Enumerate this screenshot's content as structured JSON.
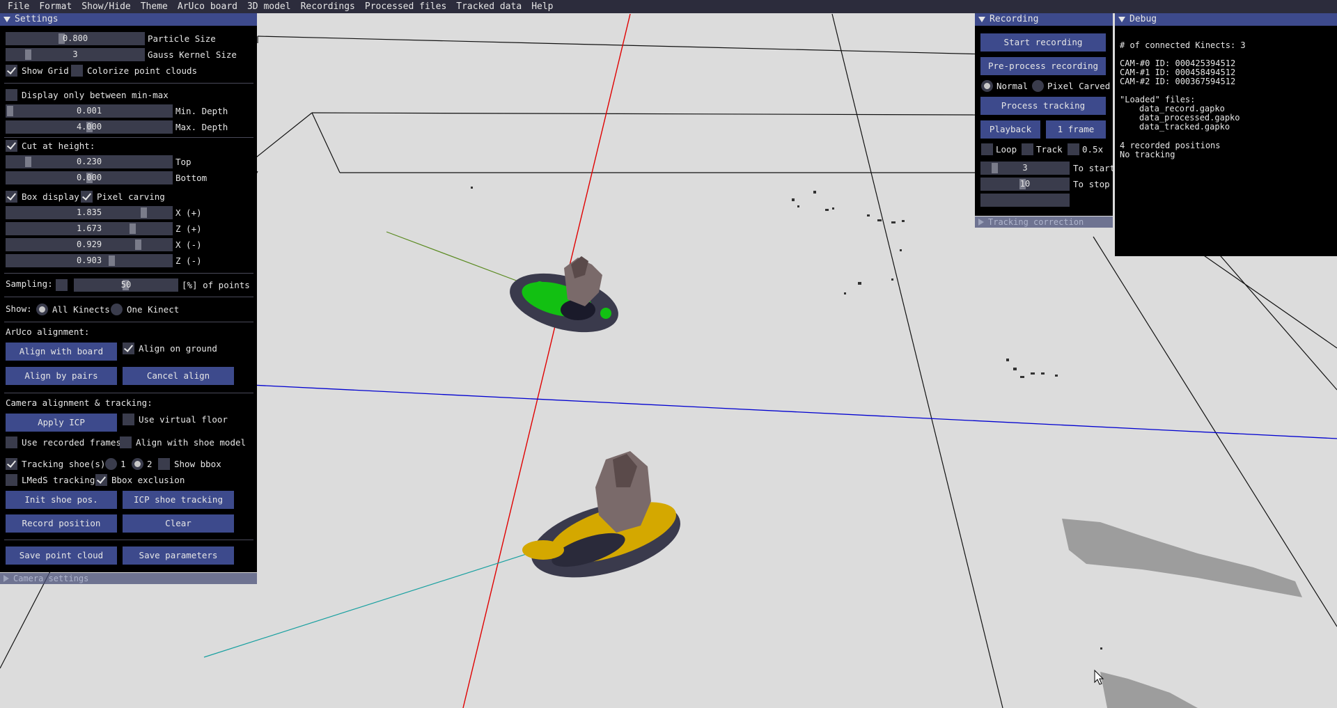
{
  "menubar": [
    "File",
    "Format",
    "Show/Hide",
    "Theme",
    "ArUco board",
    "3D model",
    "Recordings",
    "Processed files",
    "Tracked data",
    "Help"
  ],
  "settings": {
    "title": "Settings",
    "particle_size": {
      "value": "0.800",
      "label": "Particle Size"
    },
    "gauss_kernel": {
      "value": "3",
      "label": "Gauss Kernel Size"
    },
    "show_grid": "Show Grid",
    "colorize": "Colorize point clouds",
    "display_minmax": "Display only between min-max",
    "min_depth": {
      "value": "0.001",
      "label": "Min. Depth"
    },
    "max_depth": {
      "value": "4.000",
      "label": "Max. Depth"
    },
    "cut_height": "Cut at height:",
    "top": {
      "value": "0.230",
      "label": "Top"
    },
    "bottom": {
      "value": "0.000",
      "label": "Bottom"
    },
    "box_display": "Box display",
    "pixel_carving": "Pixel carving",
    "x_plus": {
      "value": "1.835",
      "label": "X (+)"
    },
    "z_plus": {
      "value": "1.673",
      "label": "Z (+)"
    },
    "x_minus": {
      "value": "0.929",
      "label": "X (-)"
    },
    "z_minus": {
      "value": "0.903",
      "label": "Z (-)"
    },
    "sampling_label": "Sampling:",
    "sampling": {
      "value": "50",
      "label": "[%] of points"
    },
    "show_label": "Show:",
    "all_kinects": "All Kinects",
    "one_kinect": "One Kinect",
    "aruco_alignment": "ArUco alignment:",
    "align_with_board": "Align with board",
    "align_on_ground": "Align on ground",
    "align_by_pairs": "Align by pairs",
    "cancel_align": "Cancel align",
    "camera_alignment": "Camera alignment & tracking:",
    "apply_icp": "Apply ICP",
    "use_virtual_floor": "Use virtual floor",
    "use_recorded_frames": "Use recorded frames",
    "align_with_shoe_model": "Align with shoe model",
    "tracking_shoes": "Tracking shoe(s)",
    "shoe_1": "1",
    "shoe_2": "2",
    "show_bbox": "Show bbox",
    "lmeds_tracking": "LMedS tracking",
    "bbox_exclusion": "Bbox exclusion",
    "init_shoe_pos": "Init shoe pos.",
    "icp_shoe_tracking": "ICP shoe tracking",
    "record_position": "Record position",
    "clear": "Clear",
    "save_point_cloud": "Save point cloud",
    "save_parameters": "Save parameters",
    "camera_settings": "Camera settings"
  },
  "recording": {
    "title": "Recording",
    "start_recording": "Start recording",
    "preprocess_recording": "Pre-process recording",
    "normal": "Normal",
    "pixel_carved": "Pixel Carved",
    "process_tracking": "Process tracking",
    "playback": "Playback",
    "one_frame": "1 frame",
    "loop": "Loop",
    "track": "Track",
    "half_x": "0.5x",
    "to_start": {
      "value": "3",
      "label": "To start"
    },
    "to_stop": {
      "value": "10",
      "label": "To stop"
    },
    "tracking_correction": "Tracking correction"
  },
  "debug": {
    "title": "Debug",
    "connected": "# of connected Kinects: 3",
    "cams": [
      "CAM-#0 ID: 000425394512",
      "CAM-#1 ID: 000458494512",
      "CAM-#2 ID: 000367594512"
    ],
    "loaded_title": "\"Loaded\" files:",
    "files": [
      "data_record.gapko",
      "data_processed.gapko",
      "data_tracked.gapko"
    ],
    "recorded_positions": "4 recorded positions",
    "no_tracking": "No tracking"
  }
}
